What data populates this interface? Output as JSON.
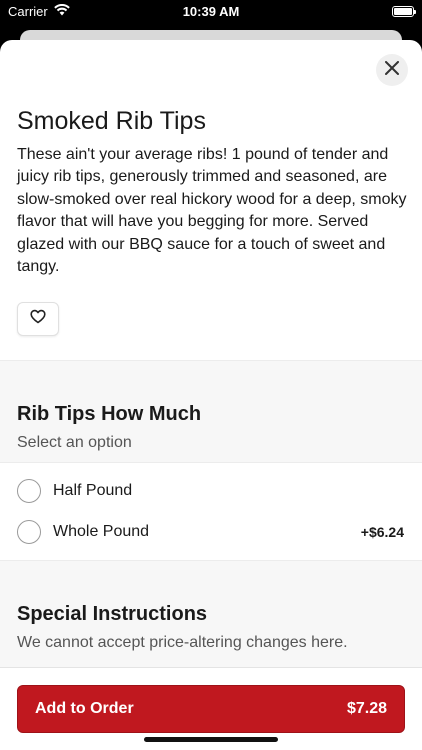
{
  "status_bar": {
    "carrier": "Carrier",
    "time": "10:39 AM",
    "wifi_icon": "wifi-icon",
    "battery_icon": "battery-icon"
  },
  "item": {
    "title": "Smoked Rib Tips",
    "description": "These ain't your average ribs! 1 pound of tender and juicy rib tips, generously trimmed and seasoned, are slow-smoked over real hickory wood for a deep, smoky flavor that will have you begging for more. Served glazed with our BBQ sauce for a touch of sweet and tangy.",
    "favorite_icon": "heart-icon",
    "close_icon": "close-icon"
  },
  "option_group": {
    "title": "Rib Tips How Much",
    "subtitle": "Select an option",
    "options": [
      {
        "label": "Half Pound",
        "price": ""
      },
      {
        "label": "Whole Pound",
        "price": "+$6.24"
      }
    ]
  },
  "special_instructions": {
    "title": "Special Instructions",
    "subtitle": "We cannot accept price-altering changes here."
  },
  "footer": {
    "button_label": "Add to Order",
    "button_price": "$7.28"
  },
  "colors": {
    "accent": "#c0181f",
    "background_black": "#000000",
    "section_gray": "#f7f7f7"
  }
}
